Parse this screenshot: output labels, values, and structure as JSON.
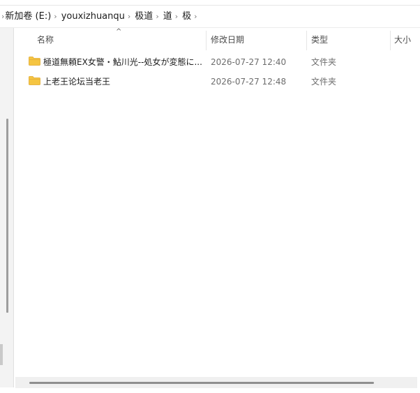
{
  "breadcrumb": {
    "items": [
      "新加卷 (E:)",
      "youxizhuanqu",
      "极道",
      "道",
      "极"
    ],
    "separator": "›"
  },
  "columns": {
    "name": "名称",
    "date": "修改日期",
    "type": "类型",
    "size": "大小",
    "sort_indicator": "^"
  },
  "files": [
    {
      "name": "極道無頼EX女警・鮎川光--処女が変態に...",
      "date": "2026-07-27 12:40",
      "type": "文件夹",
      "icon": "folder-icon"
    },
    {
      "name": "上老王论坛当老王",
      "date": "2026-07-27 12:48",
      "type": "文件夹",
      "icon": "folder-icon"
    }
  ],
  "colors": {
    "folder": "#f5c542",
    "folder_dark": "#e0a82e",
    "header_text": "#4b4b4b",
    "meta_text": "#6d6d6d"
  }
}
